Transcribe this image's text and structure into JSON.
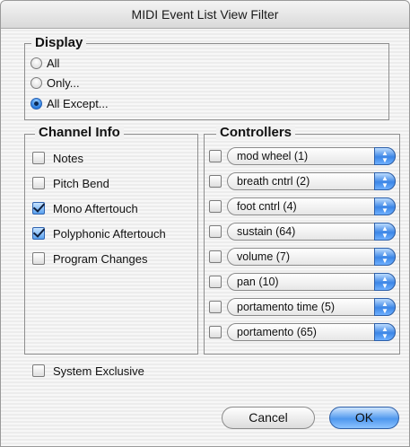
{
  "window": {
    "title": "MIDI Event List View Filter"
  },
  "display": {
    "label": "Display",
    "options": [
      {
        "label": "All",
        "selected": false
      },
      {
        "label": "Only...",
        "selected": false
      },
      {
        "label": "All Except...",
        "selected": true
      }
    ]
  },
  "channel_info": {
    "label": "Channel Info",
    "items": [
      {
        "label": "Notes",
        "checked": false
      },
      {
        "label": "Pitch Bend",
        "checked": false
      },
      {
        "label": "Mono Aftertouch",
        "checked": true
      },
      {
        "label": "Polyphonic Aftertouch",
        "checked": true
      },
      {
        "label": "Program Changes",
        "checked": false
      }
    ]
  },
  "controllers": {
    "label": "Controllers",
    "items": [
      {
        "label": "mod wheel (1)",
        "checked": false
      },
      {
        "label": "breath cntrl (2)",
        "checked": false
      },
      {
        "label": "foot cntrl (4)",
        "checked": false
      },
      {
        "label": "sustain (64)",
        "checked": false
      },
      {
        "label": "volume (7)",
        "checked": false
      },
      {
        "label": "pan (10)",
        "checked": false
      },
      {
        "label": "portamento time (5)",
        "checked": false
      },
      {
        "label": "portamento (65)",
        "checked": false
      }
    ]
  },
  "system_exclusive": {
    "label": "System Exclusive",
    "checked": false
  },
  "buttons": {
    "cancel": "Cancel",
    "ok": "OK"
  },
  "colors": {
    "accent": "#3c86e6",
    "window_bg": "#efefef"
  }
}
